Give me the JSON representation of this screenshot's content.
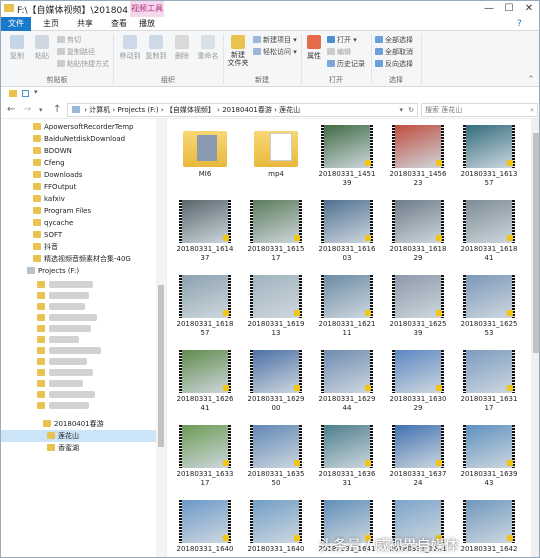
{
  "window": {
    "title": "F:\\【自媒体视频】\\201804...",
    "context_tab": "视频工具",
    "min": "—",
    "max": "☐",
    "close": "✕"
  },
  "tabs": [
    {
      "label": "文件",
      "active": true
    },
    {
      "label": "主页"
    },
    {
      "label": "共享"
    },
    {
      "label": "查看"
    },
    {
      "label": "播放"
    }
  ],
  "ribbon": {
    "clipboard": {
      "label": "剪贴板",
      "big": [
        {
          "label": "复制"
        },
        {
          "label": "粘贴"
        }
      ],
      "small": [
        "剪切",
        "复制路径",
        "粘贴快捷方式"
      ]
    },
    "organize": {
      "label": "组织",
      "items": [
        "移动到",
        "复制到",
        "删除",
        "重命名"
      ]
    },
    "new": {
      "label": "新建",
      "folder": "新建\n文件夹",
      "small": [
        "新建项目 ▾",
        "轻松访问 ▾"
      ]
    },
    "open": {
      "label": "打开",
      "props": "属性",
      "small": [
        "打开 ▾",
        "编辑",
        "历史记录"
      ]
    },
    "select": {
      "label": "选择",
      "small": [
        "全部选择",
        "全部取消",
        "反向选择"
      ]
    }
  },
  "nav": {
    "back": "←",
    "forward": "→",
    "recent": "▾",
    "up": "↑",
    "breadcrumb": [
      "计算机",
      "Projects (F:)",
      "【自媒体视频】",
      "20180401春游",
      "莲花山"
    ],
    "search_placeholder": "搜索 莲花山",
    "refresh": "↻"
  },
  "tree": [
    {
      "label": "ApowersoftRecorderTemp"
    },
    {
      "label": "BaiduNetdiskDownload"
    },
    {
      "label": "BDOWN"
    },
    {
      "label": "Cfeng"
    },
    {
      "label": "Downloads"
    },
    {
      "label": "FFOutput"
    },
    {
      "label": "kafxiv"
    },
    {
      "label": "Program Files"
    },
    {
      "label": "qycache"
    },
    {
      "label": "SOFT"
    },
    {
      "label": "抖音"
    },
    {
      "label": "精选视频音频素材合集-40G"
    }
  ],
  "drive": "Projects (F:)",
  "tree_lower": [
    {
      "label": "20180401春游"
    },
    {
      "label": "莲花山",
      "selected": true
    },
    {
      "label": "香蜜湖"
    }
  ],
  "files": [
    {
      "name": "MI6",
      "kind": "folder"
    },
    {
      "name": "mp4",
      "kind": "folder2"
    },
    {
      "name": "20180331_1451\n39",
      "c": "#3f6a42"
    },
    {
      "name": "20180331_1456\n23",
      "c": "#c04a3a"
    },
    {
      "name": "20180331_1613\n57",
      "c": "#2f6a7a"
    },
    {
      "name": "20180331_1614\n37",
      "c": "#56646a"
    },
    {
      "name": "20180331_1615\n17",
      "c": "#5a7a58"
    },
    {
      "name": "20180331_1616\n03",
      "c": "#4d6f8f"
    },
    {
      "name": "20180331_1618\n29",
      "c": "#6b7a86"
    },
    {
      "name": "20180331_1618\n41",
      "c": "#7b8a93"
    },
    {
      "name": "20180331_1618\n57",
      "c": "#8aa0ac"
    },
    {
      "name": "20180331_1619\n13",
      "c": "#9fb2bd"
    },
    {
      "name": "20180331_1621\n11",
      "c": "#6a8aa3"
    },
    {
      "name": "20180331_1625\n39",
      "c": "#8b98a8"
    },
    {
      "name": "20180331_1625\n53",
      "c": "#7a96b8"
    },
    {
      "name": "20180331_1626\n41",
      "c": "#5f8a4a"
    },
    {
      "name": "20180331_1629\n00",
      "c": "#4a6fa5"
    },
    {
      "name": "20180331_1629\n44",
      "c": "#6d8ab0"
    },
    {
      "name": "20180331_1630\n29",
      "c": "#5a86c2"
    },
    {
      "name": "20180331_1631\n17",
      "c": "#7a9ac0"
    },
    {
      "name": "20180331_1633\n17",
      "c": "#6a9a52"
    },
    {
      "name": "20180331_1635\n50",
      "c": "#5f85b5"
    },
    {
      "name": "20180331_1636\n31",
      "c": "#4a7d8a"
    },
    {
      "name": "20180331_1637\n24",
      "c": "#3e6fb0"
    },
    {
      "name": "20180331_1639\n43",
      "c": "#5b8fbf"
    },
    {
      "name": "20180331_1640\n",
      "c": "#6a98c8"
    },
    {
      "name": "20180331_1640\n",
      "c": "#6f9dc6"
    },
    {
      "name": "20180331_1641\n",
      "c": "#5e8db8"
    },
    {
      "name": "20180331_1641\n",
      "c": "#7aa3ca"
    },
    {
      "name": "20180331_1642\n",
      "c": "#6e96be"
    }
  ],
  "watermark": "头条号 / 威视界自媒体"
}
